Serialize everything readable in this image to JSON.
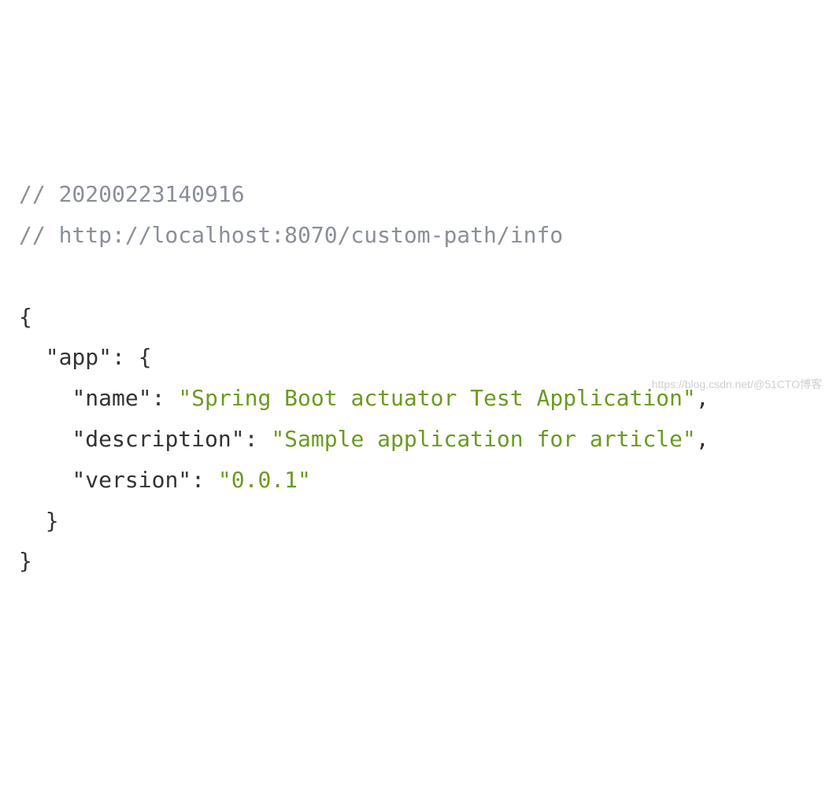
{
  "comments": {
    "line1": "// 20200223140916",
    "line2": "// http://localhost:8070/custom-path/info"
  },
  "json": {
    "open_brace": "{",
    "close_brace": "}",
    "app_key": "\"app\"",
    "app_open": "{",
    "app_close": "}",
    "name_key": "\"name\"",
    "name_value": "\"Spring Boot actuator Test Application\"",
    "description_key": "\"description\"",
    "description_value": "\"Sample application for article\"",
    "version_key": "\"version\"",
    "version_value": "\"0.0.1\"",
    "colon": ":",
    "comma": ","
  },
  "watermark": "https://blog.csdn.net/@51CTO博客"
}
